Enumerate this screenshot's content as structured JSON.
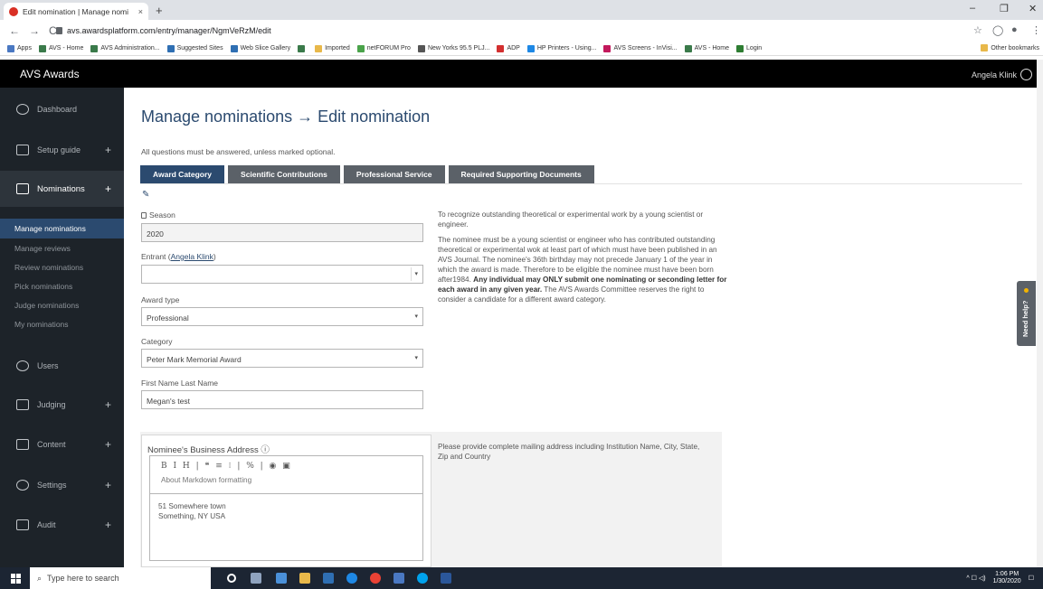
{
  "browser": {
    "tab_title": "Edit nomination | Manage nomi",
    "tab_close": "×",
    "new_tab": "+",
    "url": "avs.awardsplatform.com/entry/manager/NgmVeRzM/edit",
    "window_controls": {
      "minimize": "–",
      "restore": "❐",
      "close": "✕"
    },
    "nav": {
      "back": "←",
      "forward": "→",
      "reload": "C"
    },
    "right_icons": {
      "star": "☆",
      "ext": "◯",
      "profile": "●",
      "menu": "⋮"
    },
    "bookmarks": [
      {
        "label": "Apps",
        "color": "#4a78c2"
      },
      {
        "label": "AVS - Home",
        "color": "#3a7a4a"
      },
      {
        "label": "AVS Administration...",
        "color": "#3a7a4a"
      },
      {
        "label": "Suggested Sites",
        "color": "#2f6fb3"
      },
      {
        "label": "Web Slice Gallery",
        "color": "#2f6fb3"
      },
      {
        "label": "",
        "color": "#3a7a4a"
      },
      {
        "label": "Imported",
        "color": "#e8b84a"
      },
      {
        "label": "netFORUM Pro",
        "color": "#4aa34a"
      },
      {
        "label": "New Yorks 95.5 PLJ...",
        "color": "#555555"
      },
      {
        "label": "ADP",
        "color": "#d32f2f"
      },
      {
        "label": "HP Printers - Using...",
        "color": "#1e88e5"
      },
      {
        "label": "AVS Screens - InVisi...",
        "color": "#c2185b"
      },
      {
        "label": "AVS - Home",
        "color": "#3a7a4a"
      },
      {
        "label": "Login",
        "color": "#2e7d32"
      }
    ],
    "other_bookmarks": "Other bookmarks"
  },
  "app": {
    "brand": "AVS Awards",
    "user": "Angela Klink"
  },
  "sidebar": {
    "dashboard": "Dashboard",
    "setup_guide": "Setup guide",
    "nominations": "Nominations",
    "plus": "+",
    "sub_items": [
      "Manage nominations",
      "Manage reviews",
      "Review nominations",
      "Pick nominations",
      "Judge nominations",
      "My nominations"
    ],
    "users": "Users",
    "judging": "Judging",
    "content": "Content",
    "settings": "Settings",
    "audit": "Audit"
  },
  "main": {
    "title": "Manage nominations → Edit nomination",
    "note": "All questions must be answered, unless marked optional.",
    "tabs": [
      "Award Category",
      "Scientific Contributions",
      "Professional Service",
      "Required Supporting Documents"
    ],
    "edit_icon": "✎",
    "season_label": "Season",
    "season_value": "2020",
    "entrant_label": "Entrant (",
    "entrant_link": "Angela Klink",
    "entrant_label_end": ")",
    "entrant_value": "",
    "award_type_label": "Award type",
    "award_type_value": "Professional",
    "category_label": "Category",
    "category_value": "Peter Mark Memorial Award",
    "name_label": "First Name Last Name",
    "name_value": "Megan's test",
    "select_arrow": "▾",
    "desc_p1": "To recognize outstanding theoretical or experimental work by a young scientist or engineer.",
    "desc_p2_a": "The nominee must be a young scientist or engineer who has contributed outstanding theoretical or experimental wok at least part of which must have been published in an AVS Journal. The nominee's 36th birthday may not precede January 1 of the year in which the award is made. Therefore to be eligible the nominee must have been born after1984. ",
    "desc_p2_b": "Any individual may ONLY submit one nominating or seconding letter for each award in any given year.",
    "desc_p2_c": " The AVS Awards Committee reserves the right to consider a candidate for a different award category.",
    "address_label": "Nominee's Business Address ⓘ",
    "address_help": "Please provide complete mailing address including Institution Name, City, State, Zip and Country",
    "md_buttons": "B I H | ❝ ≡ ⁝ | % | ◉ ▣",
    "md_help": "About Markdown formatting",
    "address_line1": "51 Somewhere town",
    "address_line2": "Something, NY USA",
    "need_help": "Need help?"
  },
  "taskbar": {
    "search_placeholder": "Type here to search",
    "time": "1:06 PM",
    "date": "1/30/2020",
    "tray_icons": "^ ☐ ◁)"
  }
}
